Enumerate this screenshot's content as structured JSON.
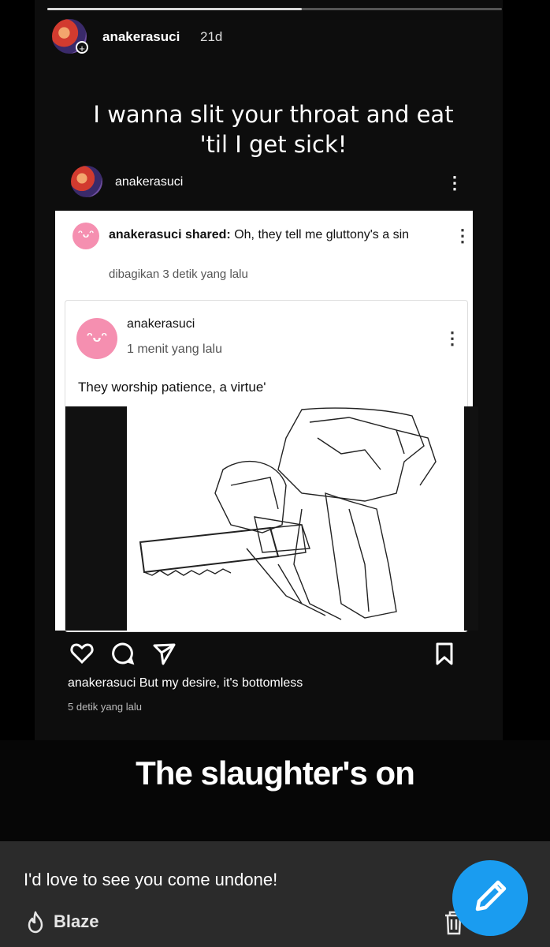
{
  "story": {
    "progress_fraction": 0.56,
    "username": "anakerasuci",
    "time": "21d",
    "plus_badge": "+",
    "caption_top": "I wanna slit your throat and eat 'til I get sick!",
    "slaughter_text": "The slaughter's on"
  },
  "post": {
    "username": "anakerasuci",
    "more": "⋮",
    "shared": {
      "user": "anakerasuci shared:",
      "text": "Oh, they tell me gluttony's a sin",
      "time": "dibagikan 3 detik yang lalu"
    },
    "inner": {
      "user": "anakerasuci",
      "time": "1 menit yang lalu",
      "text": "They worship patience, a virtue'"
    },
    "caption_user": "anakerasuci",
    "caption_text": "But my desire, it's bottomless",
    "caption_time": "5 detik yang lalu"
  },
  "panel": {
    "caption": "I'd love to see you come undone!",
    "blaze_label": "Blaze"
  },
  "icons": {
    "like": "heart-icon",
    "comment": "comment-icon",
    "share": "send-icon",
    "save": "bookmark-icon",
    "blaze": "flame-icon",
    "delete": "trash-icon",
    "edit": "pencil-icon"
  },
  "colors": {
    "fab": "#1a9cf0",
    "avatar_pink": "#f58fb0",
    "panel_bg": "#2b2b2b"
  }
}
